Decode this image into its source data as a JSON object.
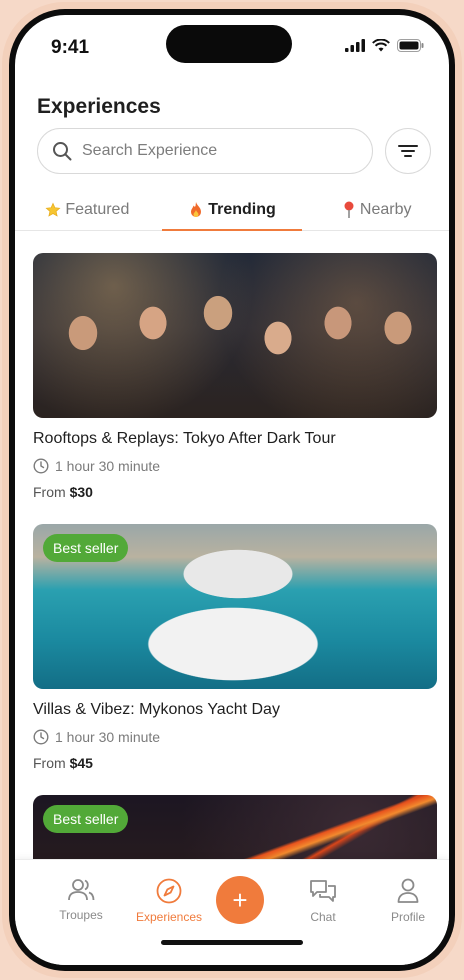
{
  "status": {
    "time": "9:41"
  },
  "header": {
    "title": "Experiences"
  },
  "search": {
    "placeholder": "Search Experience"
  },
  "tabs": [
    {
      "label": "Featured",
      "icon": "star-icon"
    },
    {
      "label": "Trending",
      "icon": "fire-icon",
      "active": true
    },
    {
      "label": "Nearby",
      "icon": "pin-icon"
    }
  ],
  "cards": [
    {
      "title": "Rooftops & Replays: Tokyo After Dark Tour",
      "duration": "1 hour 30 minute",
      "price_prefix": "From",
      "price": "$30",
      "badge": ""
    },
    {
      "title": "Villas & Vibez: Mykonos Yacht Day",
      "duration": "1 hour 30 minute",
      "price_prefix": "From",
      "price": "$45",
      "badge": "Best seller"
    },
    {
      "badge": "Best seller"
    }
  ],
  "nav": {
    "items": [
      {
        "label": "Troupes",
        "icon": "people-icon"
      },
      {
        "label": "Experiences",
        "icon": "compass-icon",
        "active": true
      },
      {
        "label": "Chat",
        "icon": "chat-icon"
      },
      {
        "label": "Profile",
        "icon": "profile-icon"
      }
    ],
    "fab_label": "+"
  },
  "colors": {
    "accent": "#f07b3c",
    "badge": "#52a938",
    "frame": "#f3d0bb"
  }
}
